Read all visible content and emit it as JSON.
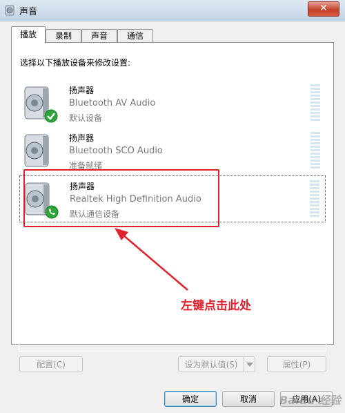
{
  "window": {
    "title": "声音",
    "close_symbol": "✕"
  },
  "tabs": [
    {
      "label": "播放",
      "active": true
    },
    {
      "label": "录制",
      "active": false
    },
    {
      "label": "声音",
      "active": false
    },
    {
      "label": "通信",
      "active": false
    }
  ],
  "panel": {
    "instruction": "选择以下播放设备来修改设置:",
    "devices": [
      {
        "name": "扬声器",
        "driver": "Bluetooth AV Audio",
        "status": "默认设备",
        "badge": "check-icon"
      },
      {
        "name": "扬声器",
        "driver": "Bluetooth SCO Audio",
        "status": "准备就绪",
        "badge": ""
      },
      {
        "name": "扬声器",
        "driver": "Realtek High Definition Audio",
        "status": "默认通信设备",
        "badge": "phone-icon"
      }
    ]
  },
  "annotation": {
    "text": "左键点击此处",
    "color": "#e0202a"
  },
  "buttons": {
    "configure": "配置(C)",
    "set_default": "设为默认值(S)",
    "properties": "属性(P)",
    "ok": "确定",
    "cancel": "取消",
    "apply": "应用(A)"
  },
  "watermark": "Baidu 经验"
}
